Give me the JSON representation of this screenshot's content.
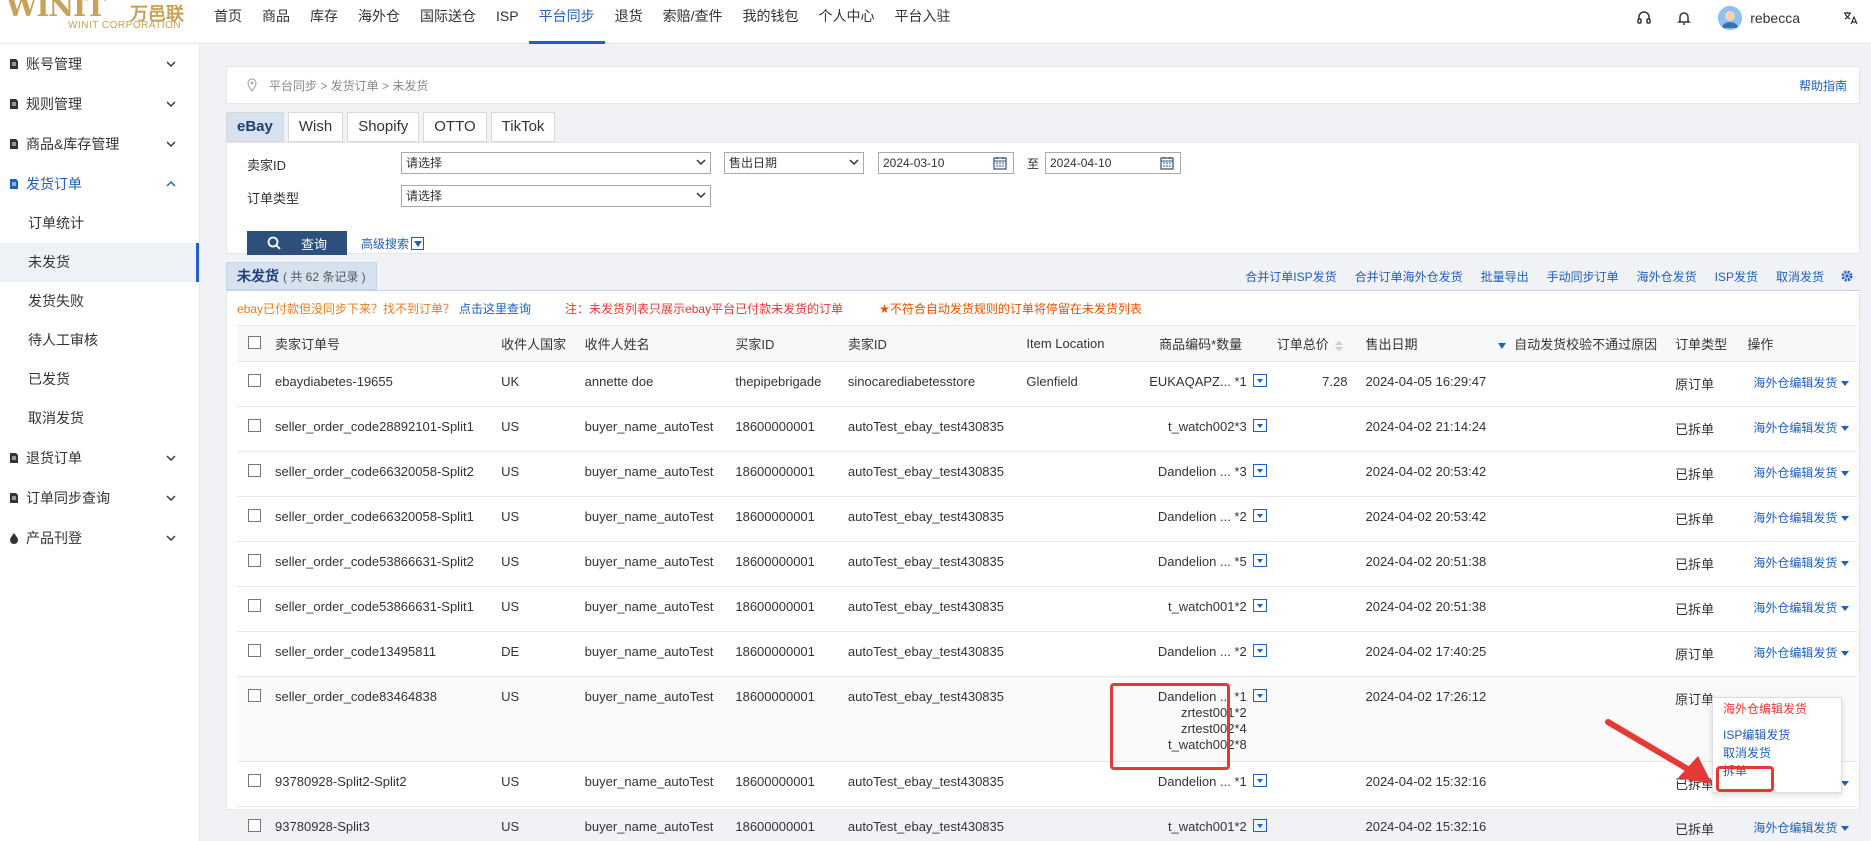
{
  "logo": {
    "brand": "WINIT",
    "brand_cn": "万邑联",
    "corp": "WINIT CORPORATION"
  },
  "nav": [
    "首页",
    "商品",
    "库存",
    "海外仓",
    "国际送仓",
    "ISP",
    "平台同步",
    "退货",
    "索赔/查件",
    "我的钱包",
    "个人中心",
    "平台入驻"
  ],
  "user": {
    "name": "rebecca"
  },
  "sidebar": {
    "groups": [
      {
        "label": "账号管理"
      },
      {
        "label": "规则管理"
      },
      {
        "label": "商品&库存管理"
      },
      {
        "label": "发货订单"
      },
      {
        "label": "退货订单"
      },
      {
        "label": "订单同步查询"
      },
      {
        "label": "产品刊登"
      }
    ],
    "sub": [
      "订单统计",
      "未发货",
      "发货失败",
      "待人工审核",
      "已发货",
      "取消发货"
    ]
  },
  "breadcrumb": "平台同步 > 发货订单 > 未发货",
  "help": "帮助指南",
  "platform_tabs": [
    "eBay",
    "Wish",
    "Shopify",
    "OTTO",
    "TikTok"
  ],
  "filter": {
    "seller_label": "卖家ID",
    "seller_value": "请选择",
    "date_type": "售出日期",
    "date_from": "2024-03-10",
    "to": "至",
    "date_to": "2024-04-10",
    "order_type_label": "订单类型",
    "order_type_value": "请选择",
    "query": "查询",
    "advanced": "高级搜索"
  },
  "list": {
    "title": "未发货",
    "count": "( 共 62 条记录 )",
    "actions": [
      "合并订单ISP发货",
      "合并订单海外仓发货",
      "批量导出",
      "手动同步订单",
      "海外仓发货",
      "ISP发货",
      "取消发货"
    ]
  },
  "notes": {
    "orange": "ebay已付款但没同步下来？找不到订单？",
    "link": "点击这里查询",
    "red": "注：未发货列表只展示ebay平台已付款未发货的订单",
    "star": "★不符合自动发货规则的订单将停留在未发货列表"
  },
  "columns": [
    "卖家订单号",
    "收件人国家",
    "收件人姓名",
    "买家ID",
    "卖家ID",
    "Item Location",
    "商品编码*数量",
    "订单总价",
    "售出日期",
    "自动发货校验不通过原因",
    "订单类型",
    "操作"
  ],
  "rows": [
    {
      "order": "ebaydiabetes-19655",
      "country": "UK",
      "name": "annette doe",
      "buyer": "thepipebrigade",
      "seller": "sinocarediabetesstore",
      "loc": "Glenfield",
      "sku": [
        "EUKAQAPZ...  *1"
      ],
      "total": "7.28",
      "date": "2024-04-05 16:29:47",
      "reason": "",
      "type": "原订单",
      "op": "海外仓编辑发货"
    },
    {
      "order": "seller_order_code28892101-Split1",
      "country": "US",
      "name": "buyer_name_autoTest",
      "buyer": "18600000001",
      "seller": "autoTest_ebay_test430835",
      "loc": "",
      "sku": [
        "t_watch002*3"
      ],
      "total": "",
      "date": "2024-04-02 21:14:24",
      "reason": "",
      "type": "已拆单",
      "op": "海外仓编辑发货"
    },
    {
      "order": "seller_order_code66320058-Split2",
      "country": "US",
      "name": "buyer_name_autoTest",
      "buyer": "18600000001",
      "seller": "autoTest_ebay_test430835",
      "loc": "",
      "sku": [
        "Dandelion ...  *3"
      ],
      "total": "",
      "date": "2024-04-02 20:53:42",
      "reason": "",
      "type": "已拆单",
      "op": "海外仓编辑发货"
    },
    {
      "order": "seller_order_code66320058-Split1",
      "country": "US",
      "name": "buyer_name_autoTest",
      "buyer": "18600000001",
      "seller": "autoTest_ebay_test430835",
      "loc": "",
      "sku": [
        "Dandelion ...  *2"
      ],
      "total": "",
      "date": "2024-04-02 20:53:42",
      "reason": "",
      "type": "已拆单",
      "op": "海外仓编辑发货"
    },
    {
      "order": "seller_order_code53866631-Split2",
      "country": "US",
      "name": "buyer_name_autoTest",
      "buyer": "18600000001",
      "seller": "autoTest_ebay_test430835",
      "loc": "",
      "sku": [
        "Dandelion ...  *5"
      ],
      "total": "",
      "date": "2024-04-02 20:51:38",
      "reason": "",
      "type": "已拆单",
      "op": "海外仓编辑发货"
    },
    {
      "order": "seller_order_code53866631-Split1",
      "country": "US",
      "name": "buyer_name_autoTest",
      "buyer": "18600000001",
      "seller": "autoTest_ebay_test430835",
      "loc": "",
      "sku": [
        "t_watch001*2"
      ],
      "total": "",
      "date": "2024-04-02 20:51:38",
      "reason": "",
      "type": "已拆单",
      "op": "海外仓编辑发货"
    },
    {
      "order": "seller_order_code13495811",
      "country": "DE",
      "name": "buyer_name_autoTest",
      "buyer": "18600000001",
      "seller": "autoTest_ebay_test430835",
      "loc": "",
      "sku": [
        "Dandelion ...  *2"
      ],
      "total": "",
      "date": "2024-04-02 17:40:25",
      "reason": "",
      "type": "原订单",
      "op": "海外仓编辑发货"
    },
    {
      "order": "seller_order_code83464838",
      "country": "US",
      "name": "buyer_name_autoTest",
      "buyer": "18600000001",
      "seller": "autoTest_ebay_test430835",
      "loc": "",
      "sku": [
        "Dandelion ...  *1",
        "zrtest001*2",
        "zrtest002*4",
        "t_watch002*8"
      ],
      "total": "",
      "date": "2024-04-02 17:26:12",
      "reason": "",
      "type": "原订单",
      "op": ""
    },
    {
      "order": "93780928-Split2-Split2",
      "country": "US",
      "name": "buyer_name_autoTest",
      "buyer": "18600000001",
      "seller": "autoTest_ebay_test430835",
      "loc": "",
      "sku": [
        "Dandelion ...  *1"
      ],
      "total": "",
      "date": "2024-04-02 15:32:16",
      "reason": "",
      "type": "已拆单",
      "op": "海外仓编辑发货"
    },
    {
      "order": "93780928-Split3",
      "country": "US",
      "name": "buyer_name_autoTest",
      "buyer": "18600000001",
      "seller": "autoTest_ebay_test430835",
      "loc": "",
      "sku": [
        "t_watch001*2"
      ],
      "total": "",
      "date": "2024-04-02 15:32:16",
      "reason": "",
      "type": "已拆单",
      "op": "海外仓编辑发货"
    }
  ],
  "popup": [
    "海外仓编辑发货",
    "ISP编辑发货",
    "取消发货",
    "拆单"
  ],
  "colors": {
    "accent": "#1f5fbf",
    "danger": "#e53935",
    "warn": "#e67e22"
  }
}
